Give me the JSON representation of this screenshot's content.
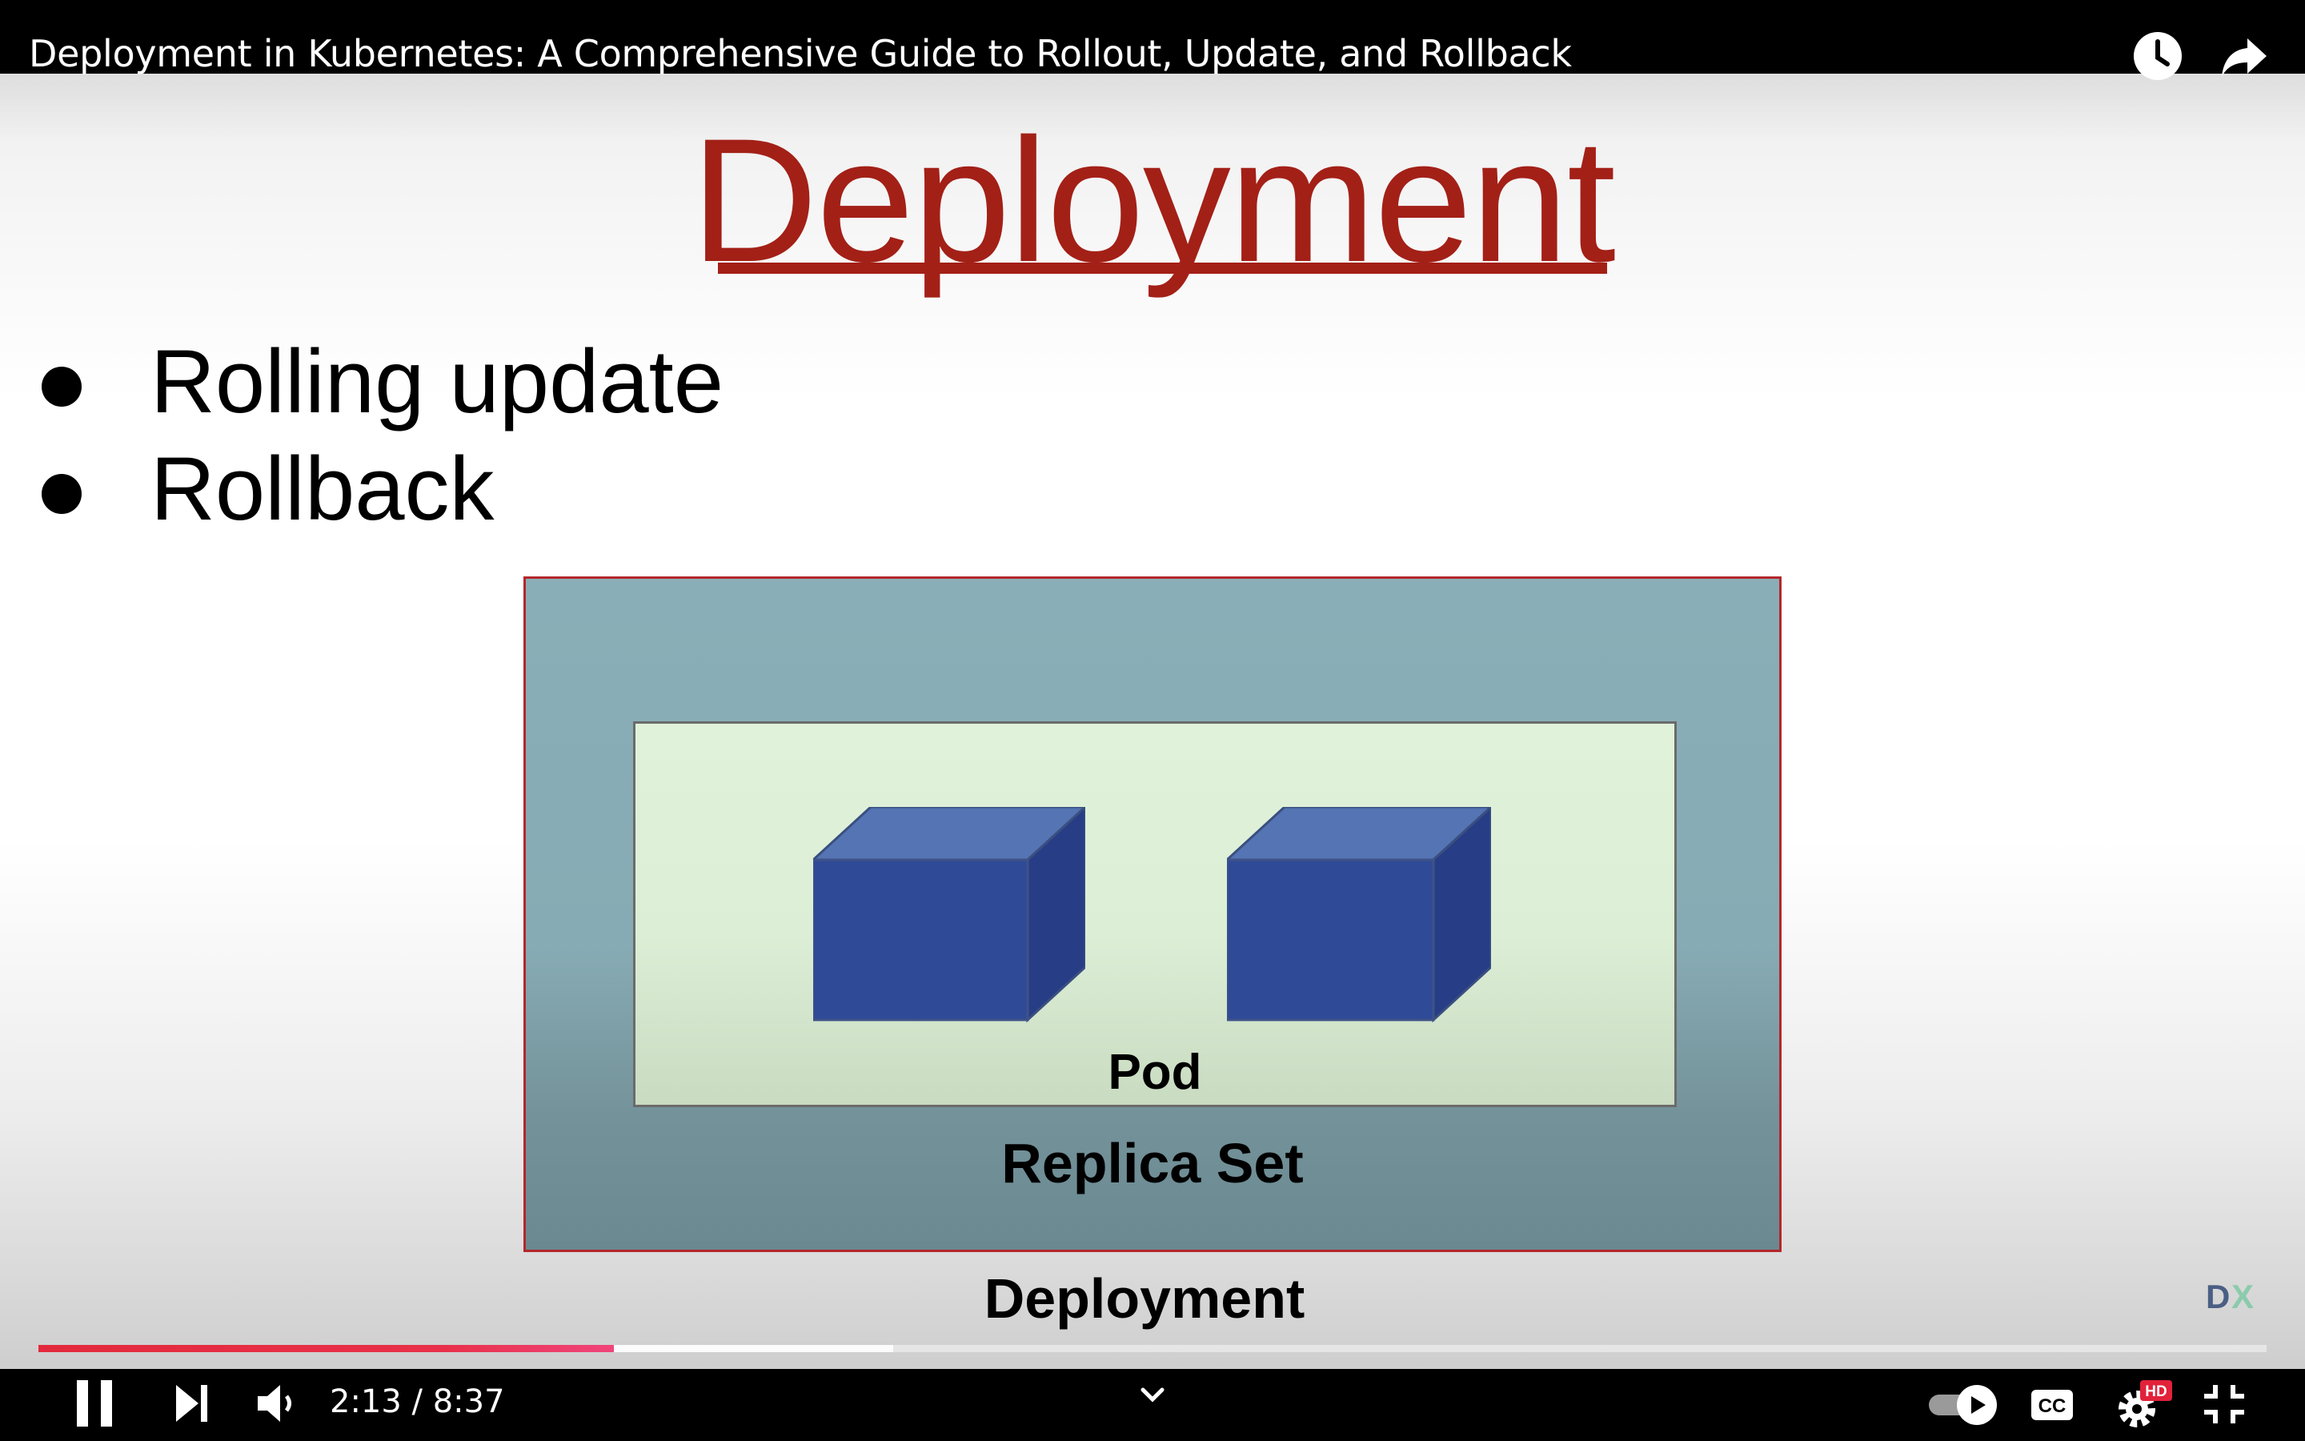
{
  "player": {
    "title": "Deployment in Kubernetes: A Comprehensive Guide to Rollout, Update, and Rollback",
    "current_time": "2:13",
    "duration": "8:37",
    "time_text": "2:13 / 8:37",
    "progress_played_fraction": 0.2584,
    "progress_buffered_fraction": 0.3836,
    "accent_color": "#e32a3c",
    "settings_badge": "HD",
    "icons": {
      "watch_later": "clock-icon",
      "share": "share-arrow-icon",
      "play_pause": "pause-icon",
      "next": "skip-next-icon",
      "volume": "volume-icon",
      "chevron": "chevron-down-icon",
      "autoplay": "autoplay-toggle-icon",
      "captions": "cc-icon",
      "settings": "gear-icon",
      "fullscreen": "exit-fullscreen-icon"
    }
  },
  "slide": {
    "heading": "Deployment",
    "heading_color": "#a32017",
    "bullets": [
      "Rolling update",
      "Rollback"
    ],
    "diagram": {
      "pod_label": "Pod",
      "replica_set_label": "Replica Set",
      "deployment_label": "Deployment",
      "outer_border_color": "#b3272a",
      "cube_color": "#2f4a96"
    },
    "channel_logo": "DX"
  }
}
